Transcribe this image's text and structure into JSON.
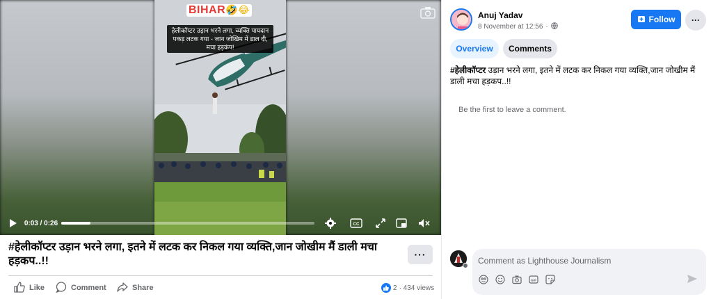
{
  "video": {
    "overlay_badge": "BIHAR",
    "overlay_emoji": "🤣😂",
    "overlay_caption": "हेलीकॉप्टर उड़ान भरने लगा, व्यक्ति पायदान पकड़ लटक गया - जान जोखिम में डाल दी, मचा हड़कंप!",
    "time_display": "0:03 / 0:26",
    "progress": 0.115
  },
  "post": {
    "title": "#हेलीकॉप्टर उड़ान भरने लगा, इतने में लटक कर निकल गया व्यक्ति,जान जोखीम मैं डाली मचा हड़कप..!!",
    "more_label": "···",
    "actions": {
      "like": "Like",
      "comment": "Comment",
      "share": "Share"
    },
    "reaction_count": "2",
    "views": "· 434 views"
  },
  "sidebar": {
    "author": "Anuj Yadav",
    "date": "8 November at 12:56",
    "follow_label": "Follow",
    "more_label": "···",
    "tabs": {
      "overview": "Overview",
      "comments": "Comments"
    },
    "hashtag": "#हेलीकॉप्टर",
    "post_text_rest": " उड़ान भरने लगा, इतने में लटक कर निकल गया व्यक्ति,जान जोखीम मैं डाली मचा हड़कप..!!",
    "empty_comments": "Be the first to leave a comment.",
    "comment_placeholder": "Comment as Lighthouse Journalism"
  },
  "colors": {
    "accent": "#1877f2",
    "muted": "#65676b",
    "surface": "#f0f2f5"
  }
}
